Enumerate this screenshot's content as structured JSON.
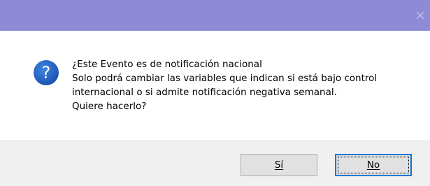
{
  "dialog": {
    "close_icon": "close-icon",
    "question_icon": "question-icon",
    "question_mark": "?",
    "message_lines": [
      "¿Este Evento es de notificación nacional",
      "Solo podrá cambiar las variables que indican si está bajo control",
      "internacional o si admite notificación negativa semanal.",
      "Quiere hacerlo?"
    ],
    "buttons": {
      "yes_label": "Sí",
      "no_label": "No"
    },
    "colors": {
      "titlebar": "#8e8ad6",
      "icon": "#1a5fbf",
      "focus_border": "#0078d7"
    }
  }
}
